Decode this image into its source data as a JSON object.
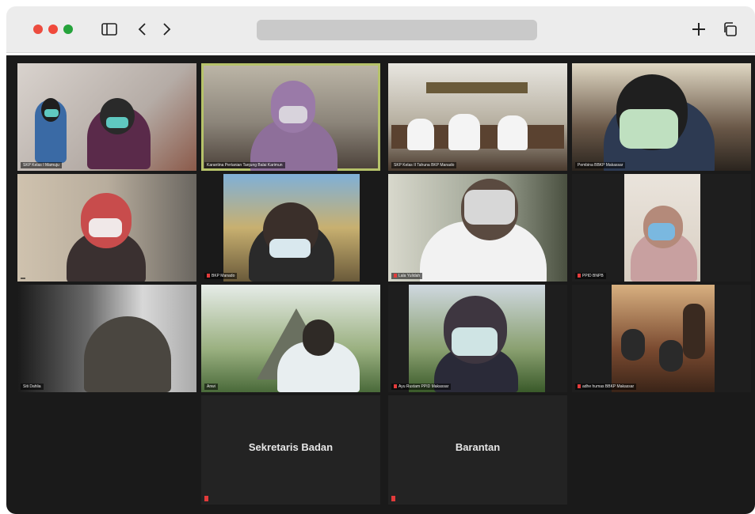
{
  "browser": {
    "address": ""
  },
  "tiles": [
    {
      "name": "SKP Kelas I Mamuju"
    },
    {
      "name": "Karantina Pertanian Tanjung Balai Karimun"
    },
    {
      "name": "SKP Kelas II Tahuna BKP Manado"
    },
    {
      "name": "Pembina BBKP Makassar"
    },
    {
      "name": ""
    },
    {
      "name": "BKP Manado"
    },
    {
      "name": "Lala Yulidah"
    },
    {
      "name": "PPID BNPB"
    },
    {
      "name": "Siti Dahlia"
    },
    {
      "name": "Anwi"
    },
    {
      "name": "Ayu Rustam PPID Makassar"
    },
    {
      "name": "adhe humas BBKP Makassar"
    }
  ],
  "placeholders": [
    {
      "label": "Sekretaris Badan"
    },
    {
      "label": "Barantan"
    }
  ],
  "colors": {
    "active_speaker_border": "#b6c26a",
    "muted": "#e23b3b"
  }
}
